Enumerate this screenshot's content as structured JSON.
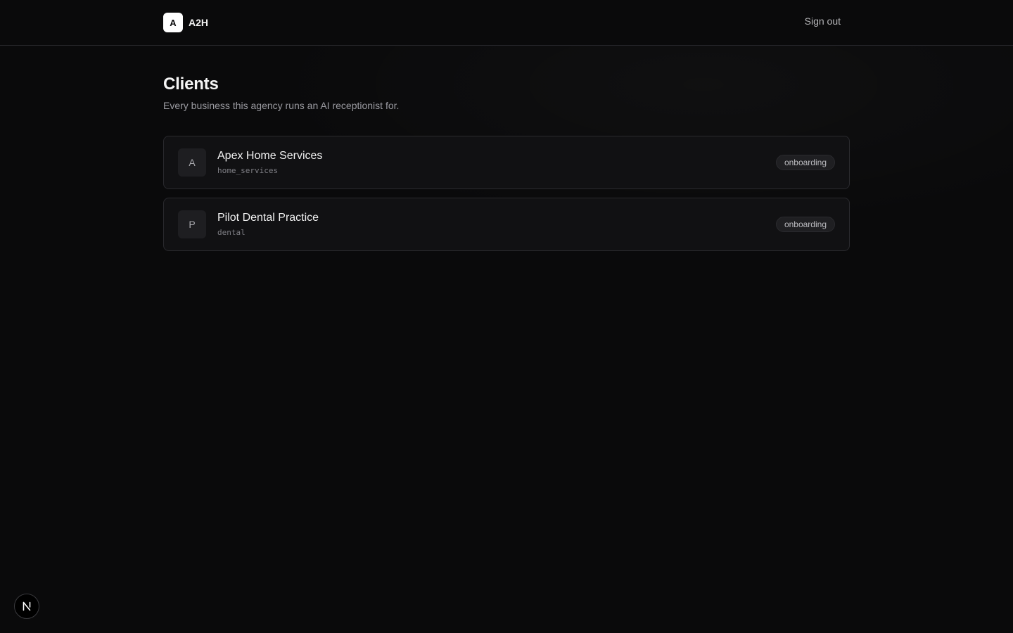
{
  "header": {
    "logo_letter": "A",
    "brand_name": "A2H",
    "sign_out_label": "Sign out"
  },
  "page": {
    "title": "Clients",
    "subtitle": "Every business this agency runs an AI receptionist for."
  },
  "clients": [
    {
      "initial": "A",
      "name": "Apex Home Services",
      "industry": "home_services",
      "status": "onboarding"
    },
    {
      "initial": "P",
      "name": "Pilot Dental Practice",
      "industry": "dental",
      "status": "onboarding"
    }
  ],
  "dev_indicator": {
    "letter": "N",
    "icon": "nextjs-icon"
  }
}
